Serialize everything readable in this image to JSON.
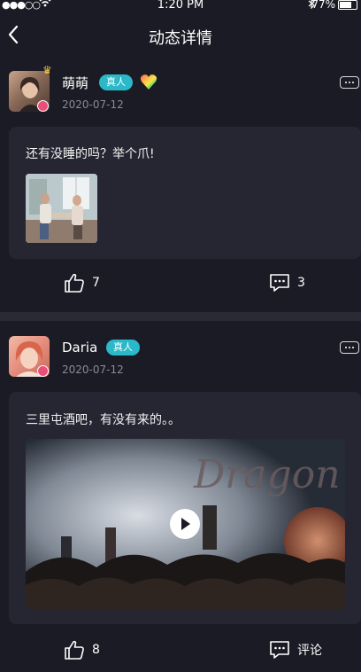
{
  "status_bar": {
    "signal": "●●●○○",
    "time": "1:20 PM",
    "battery": "77%"
  },
  "nav": {
    "title": "动态详情"
  },
  "posts": [
    {
      "username": "萌萌",
      "badge": "真人",
      "date": "2020-07-12",
      "text": "还有没睡的吗？举个爪!",
      "likes": "7",
      "comments": "3"
    },
    {
      "username": "Daria",
      "badge": "真人",
      "date": "2020-07-12",
      "text": "三里屯酒吧，有没有来的。。",
      "likes": "8",
      "comments": "评论"
    }
  ]
}
